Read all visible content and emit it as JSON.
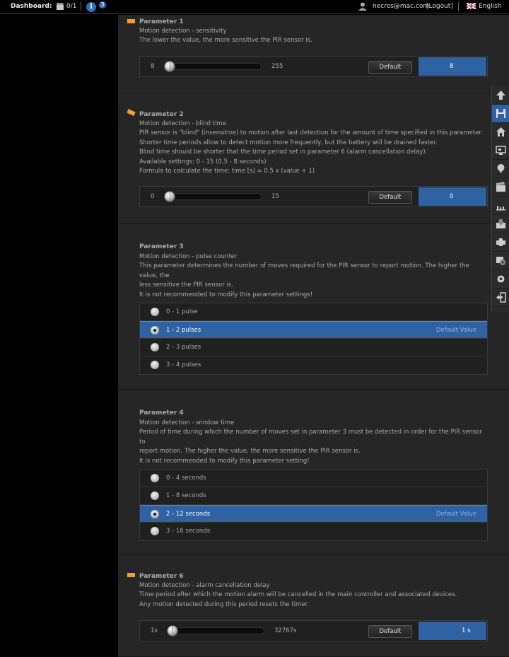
{
  "topbar": {
    "dashboard_label": "Dashboard:",
    "counter": "0/1",
    "info_badge": "3",
    "info_letter": "i",
    "user": "necros@mac.com",
    "logout": "[Logout]",
    "language": "English"
  },
  "icons": {
    "clapper": "clapperboard-icon",
    "info": "info-icon",
    "user": "user-icon",
    "flag": "uk-flag-icon"
  },
  "colors": {
    "accent": "#2f62a2",
    "flag_orange": "#f0a030",
    "panel_bg": "#262626"
  },
  "params": [
    {
      "title": "Parameter 1",
      "lines": [
        "Motion detection - sensitivity",
        "The lower the value, the more sensitive the PIR sensor is."
      ],
      "slider": {
        "min": "8",
        "max": "255",
        "default_label": "Default",
        "value": "8",
        "position": 0
      }
    },
    {
      "title": "Parameter 2",
      "lines": [
        "Motion detection - blind time",
        "PIR sensor is \"blind\" (insensitive) to motion after last detection for the amount of time specified in this parameter.",
        "Shorter time periods allow to detect motion more frequently, but the battery will be drained faster.",
        "Blind time should be shorter that the time period set in parameter 6 (alarm cancellation delay).",
        "Available settings: 0 - 15 (0,5 - 8 seconds)",
        "Formula to calculate the time: time [s] = 0.5 x (value + 1)"
      ],
      "slider": {
        "min": "0",
        "max": "15",
        "default_label": "Default",
        "value": "0",
        "position": 0
      }
    },
    {
      "title": "Parameter 3",
      "lines": [
        "Motion detection - pulse counter",
        "This parameter determines the number of moves required for the PIR sensor to report motion. The higher the value, the",
        "less sensitive the PIR sensor is.",
        "It is not recommended to modify this parameter settings!"
      ],
      "options": [
        "0 - 1 pulse",
        "1 - 2 pulses",
        "2 - 3 pulses",
        "3 - 4 pulses"
      ],
      "selected": 1,
      "default_value_label": "Default Value"
    },
    {
      "title": "Parameter 4",
      "lines": [
        "Motion detection - window time",
        "Period of time during which the number of moves set in parameter 3 must be detected in order for the PIR sensor to",
        "report motion. The higher the value, the more sensitive the PIR sensor is.",
        "It is not recommended to modify this parameter setting!"
      ],
      "options": [
        "0 - 4 seconds",
        "1 - 8 seconds",
        "2 - 12 seconds",
        "3 - 16 seconds"
      ],
      "selected": 2,
      "default_value_label": "Default Value"
    },
    {
      "title": "Parameter 6",
      "lines": [
        "Motion detection - alarm cancellation delay",
        "Time period after which the motion alarm will be cancelled in the main controller and associated devices.",
        "Any motion detected during this period resets the timer."
      ],
      "slider": {
        "min": "1s",
        "max": "32767s",
        "default_label": "Default",
        "value": "1 s",
        "position": 0
      }
    }
  ],
  "toolbar": [
    "arrow-up-icon",
    "save-icon",
    "home-icon",
    "devices-icon",
    "location-pin-icon",
    "scenes-icon",
    "chart-icon",
    "download-icon",
    "plugins-icon",
    "settings-icon",
    "soccer-icon",
    "logout-icon"
  ],
  "toolbar_active": 1
}
